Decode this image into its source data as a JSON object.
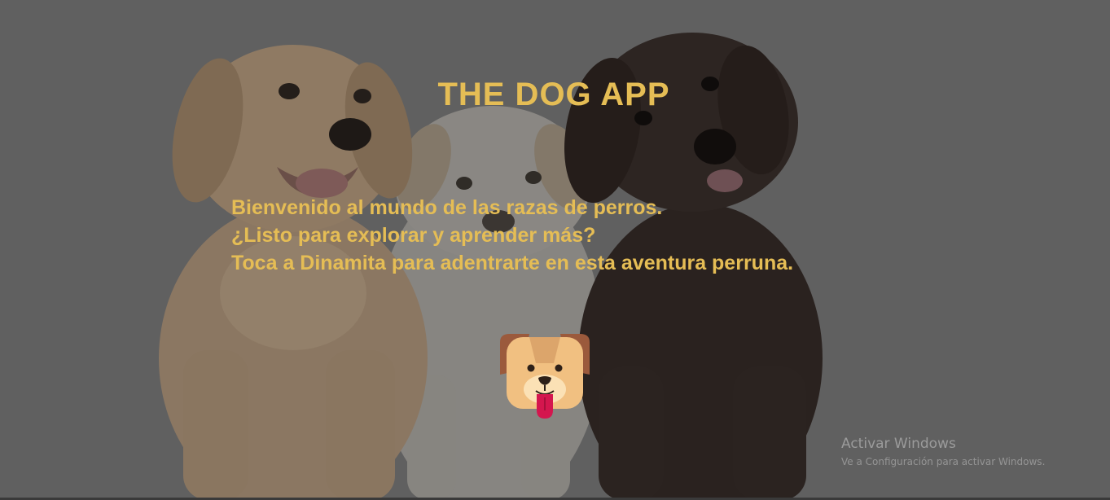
{
  "app": {
    "title": "THE DOG APP"
  },
  "intro": {
    "line1": "Bienvenido al mundo de las razas de perros.",
    "line2": "¿Listo para explorar y aprender más?",
    "line3": "Toca a Dinamita para adentrarte en esta aventura perruna."
  },
  "mascot": {
    "name": "Dinamita",
    "icon": "dog-face-icon"
  },
  "background": {
    "description_icon": "three-puppies-image"
  },
  "watermark": {
    "title": "Activar Windows",
    "subtitle": "Ve a Configuración para activar Windows."
  },
  "colors": {
    "accent": "#e5bd55",
    "background": "#606060",
    "watermark": "#9b9b9b"
  }
}
